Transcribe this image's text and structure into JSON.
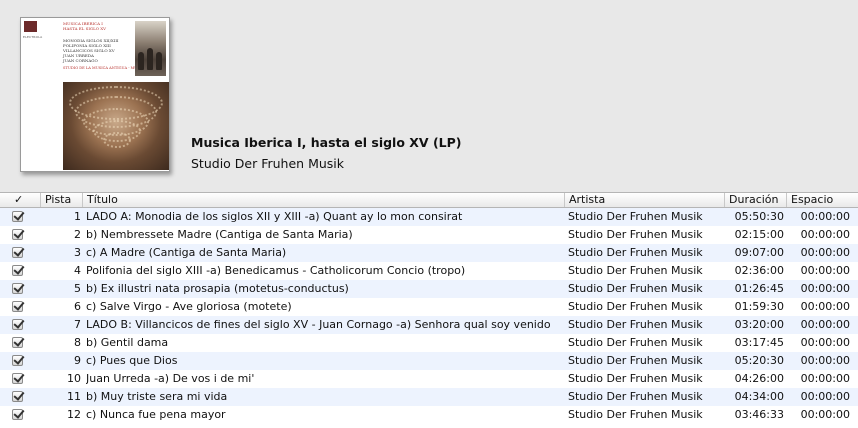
{
  "album": {
    "title": "Musica Iberica I, hasta el siglo XV (LP)",
    "artist": "Studio Der Fruhen Musik",
    "cover": {
      "logo_text": "ELECTROLA",
      "line1": "MUSICA IBERICA I",
      "line2": "HASTA EL SIGLO XV",
      "line3": "MONODIA SIGLOS XII/XIII",
      "line4": "POLIFONIA SIGLO XIII",
      "line5": "VILLANCICOS SIGLO XV",
      "line6": "JUAN URREDA",
      "line7": "JUAN CORNAGO",
      "line8": "STUDIO DE LA MUSICA ANTIGUA - MUNICH"
    }
  },
  "columns": {
    "check": "✓",
    "track": "Pista",
    "title": "Título",
    "artist": "Artista",
    "duration": "Duración",
    "space": "Espacio"
  },
  "tracks": [
    {
      "num": "1",
      "title": "LADO A: Monodia de los siglos XII y XIII -a) Quant ay lo mon consirat",
      "artist": "Studio Der Fruhen Musik",
      "duration": "05:50:30",
      "space": "00:00:00"
    },
    {
      "num": "2",
      "title": "b) Nembressete Madre (Cantiga de Santa Maria)",
      "artist": "Studio Der Fruhen Musik",
      "duration": "02:15:00",
      "space": "00:00:00"
    },
    {
      "num": "3",
      "title": "c) A Madre (Cantiga de Santa Maria)",
      "artist": "Studio Der Fruhen Musik",
      "duration": "09:07:00",
      "space": "00:00:00"
    },
    {
      "num": "4",
      "title": "Polifonia del siglo XIII -a) Benedicamus - Catholicorum Concio (tropo)",
      "artist": "Studio Der Fruhen Musik",
      "duration": "02:36:00",
      "space": "00:00:00"
    },
    {
      "num": "5",
      "title": "b) Ex illustri nata prosapia (motetus-conductus)",
      "artist": "Studio Der Fruhen Musik",
      "duration": "01:26:45",
      "space": "00:00:00"
    },
    {
      "num": "6",
      "title": "c) Salve Virgo - Ave gloriosa (motete)",
      "artist": "Studio Der Fruhen Musik",
      "duration": "01:59:30",
      "space": "00:00:00"
    },
    {
      "num": "7",
      "title": "LADO B: Villancicos de fines del siglo XV - Juan Cornago -a) Senhora qual soy venido",
      "artist": "Studio Der Fruhen Musik",
      "duration": "03:20:00",
      "space": "00:00:00"
    },
    {
      "num": "8",
      "title": "b) Gentil dama",
      "artist": "Studio Der Fruhen Musik",
      "duration": "03:17:45",
      "space": "00:00:00"
    },
    {
      "num": "9",
      "title": "c) Pues que Dios",
      "artist": "Studio Der Fruhen Musik",
      "duration": "05:20:30",
      "space": "00:00:00"
    },
    {
      "num": "10",
      "title": "Juan Urreda -a) De vos i de mi'",
      "artist": "Studio Der Fruhen Musik",
      "duration": "04:26:00",
      "space": "00:00:00"
    },
    {
      "num": "11",
      "title": "b) Muy triste sera mi vida",
      "artist": "Studio Der Fruhen Musik",
      "duration": "04:34:00",
      "space": "00:00:00"
    },
    {
      "num": "12",
      "title": "c) Nunca fue pena mayor",
      "artist": "Studio Der Fruhen Musik",
      "duration": "03:46:33",
      "space": "00:00:00"
    }
  ]
}
